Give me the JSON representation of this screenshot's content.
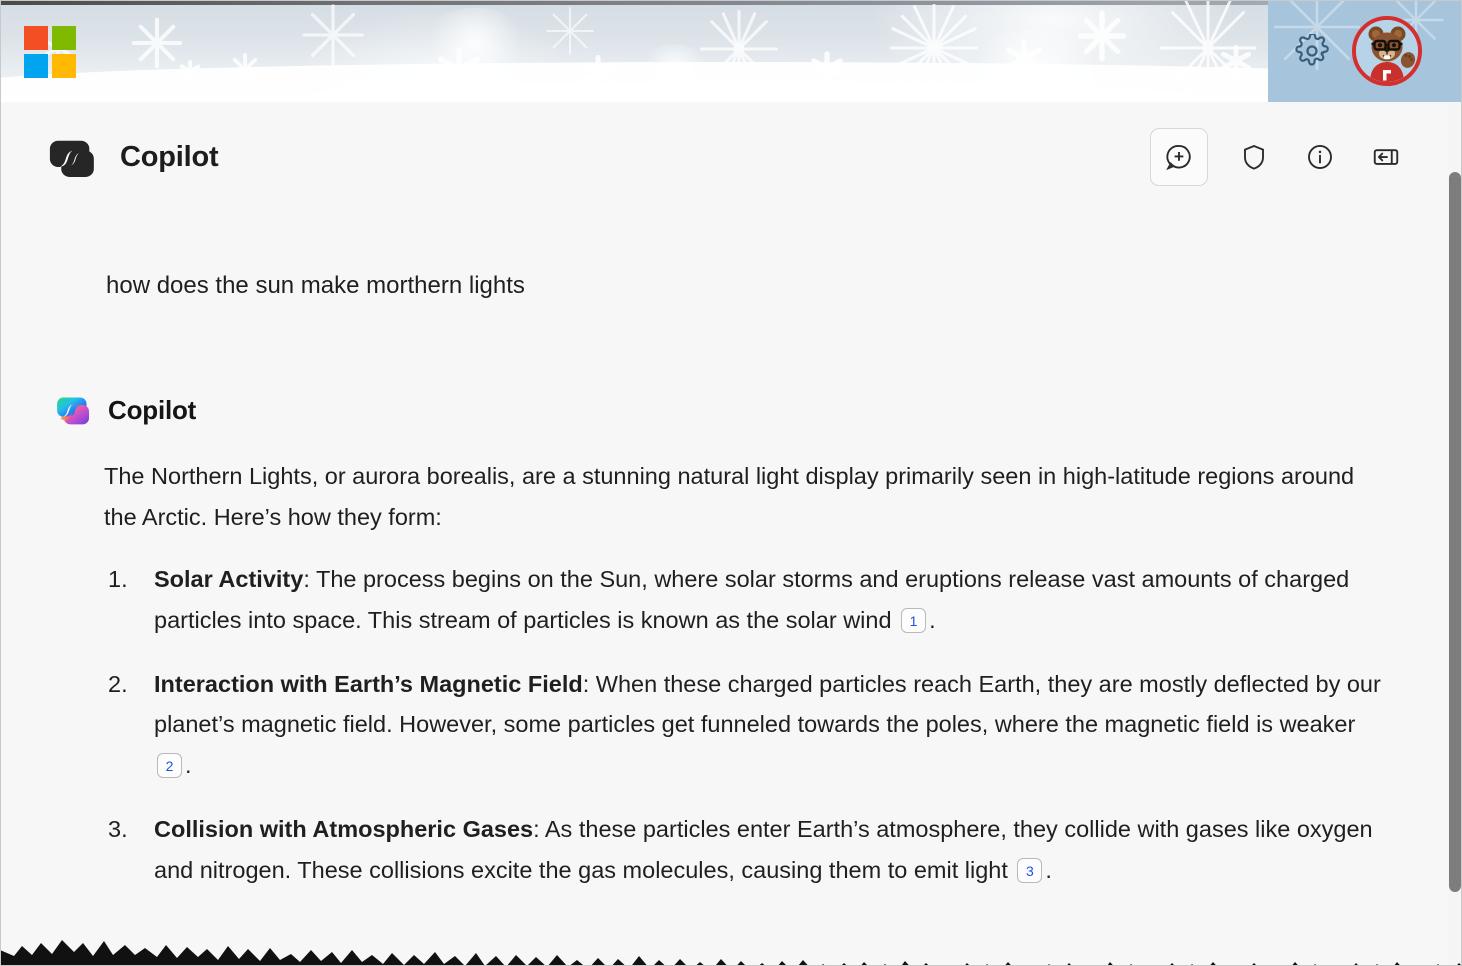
{
  "window": {
    "app_name": "Copilot",
    "brand_logo": "microsoft-logo",
    "banner_theme": "winter-snowflakes"
  },
  "header": {
    "ms_logo_colors": [
      "#f25022",
      "#7fba00",
      "#00a4ef",
      "#ffb900"
    ],
    "settings_icon": "gear-icon",
    "avatar_icon": "bear-avatar",
    "right_panel_color": "#a6c5dd",
    "avatar_ring_color": "#d32f2f"
  },
  "app_header": {
    "title": "Copilot",
    "logo": "copilot-mono-logo",
    "tools": [
      {
        "name": "new-chat-button",
        "icon": "chat-plus-icon",
        "boxed": true
      },
      {
        "name": "privacy-button",
        "icon": "shield-icon",
        "boxed": false
      },
      {
        "name": "info-button",
        "icon": "info-circle-icon",
        "boxed": false
      },
      {
        "name": "collapse-panel-button",
        "icon": "panel-collapse-icon",
        "boxed": false
      }
    ]
  },
  "conversation": {
    "user_message": "how does the sun make morthern lights",
    "assistant": {
      "name": "Copilot",
      "logo": "copilot-gradient-logo",
      "intro": "The Northern Lights, or aurora borealis, are a stunning natural light display primarily seen in high-latitude regions around the Arctic. Here’s how they form:",
      "steps": [
        {
          "number": "1.",
          "title": "Solar Activity",
          "body": ": The process begins on the Sun, where solar storms and eruptions release vast amounts of charged particles into space. This stream of particles is known as the solar wind ",
          "citation": "1",
          "tail": "."
        },
        {
          "number": "2.",
          "title": "Interaction with Earth’s Magnetic Field",
          "body": ": When these charged particles reach Earth, they are mostly deflected by our planet’s magnetic field. However, some particles get funneled towards the poles, where the magnetic field is weaker ",
          "citation": "2",
          "tail": "."
        },
        {
          "number": "3.",
          "title": "Collision with Atmospheric Gases",
          "body": ": As these particles enter Earth’s atmosphere, they collide with gases like oxygen and nitrogen. These collisions excite the gas molecules, causing them to emit light ",
          "citation": "3",
          "tail": "."
        }
      ]
    }
  },
  "scrollbar": {
    "name": "vertical-scrollbar",
    "thumb_color": "#7d7d7d"
  },
  "colors": {
    "citation_text": "#1a56db",
    "page_background": "#f7f7f7",
    "text_primary": "#1f1f1f"
  }
}
